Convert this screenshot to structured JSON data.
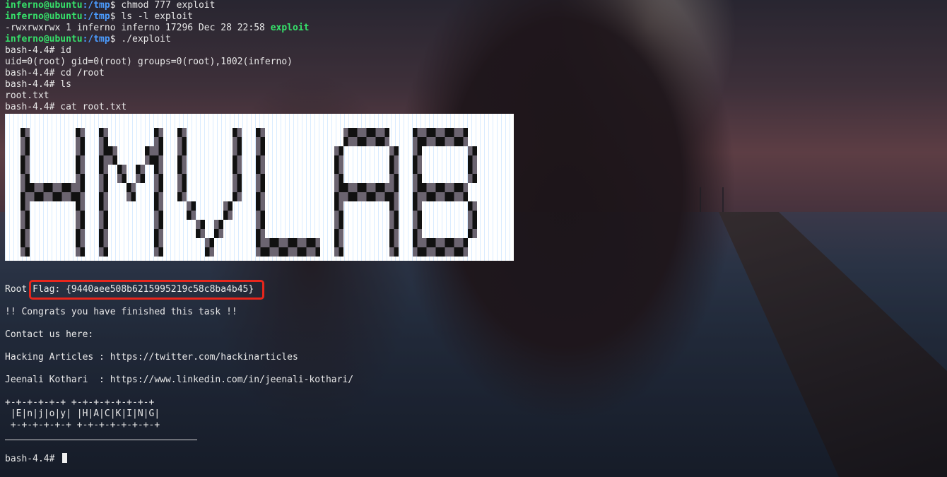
{
  "terminal": {
    "prompt_user": "inferno@ubuntu",
    "prompt_path": ":/tmp",
    "cmd_chmod": "$ chmod 777 exploit",
    "cmd_ls": "$ ls -l exploit",
    "ls_output_prefix": "-rwxrwxrwx 1 inferno inferno 17296 Dec 28 22:58 ",
    "ls_output_file": "exploit",
    "cmd_run": "$ ./exploit",
    "l_id": "bash-4.4# id",
    "l_id_out": "uid=0(root) gid=0(root) groups=0(root),1002(inferno)",
    "l_cd": "bash-4.4# cd /root",
    "l_ls": "bash-4.4# ls",
    "l_ls_out": "root.txt",
    "l_cat": "bash-4.4# cat root.txt",
    "banner_word": "HMVLAB",
    "flag_line": "Root Flag: {9440aee508b6215995219c58c8ba4b45}",
    "congrats": "!! Congrats you have finished this task !!",
    "contact": "Contact us here:",
    "hacking": "Hacking Articles : https://twitter.com/hackinarticles",
    "jeenali": "Jeenali Kothari  : https://www.linkedin.com/in/jeenali-kothari/",
    "art1": "+-+-+-+-+-+ +-+-+-+-+-+-+-+",
    "art2": " |E|n|j|o|y| |H|A|C|K|I|N|G|",
    "art3": " +-+-+-+-+-+ +-+-+-+-+-+-+-+",
    "final_prompt": "bash-4.4# "
  },
  "colors": {
    "prompt_user": "#36e06a",
    "prompt_path": "#4b9cff",
    "flag_highlight": "#e8261c"
  }
}
